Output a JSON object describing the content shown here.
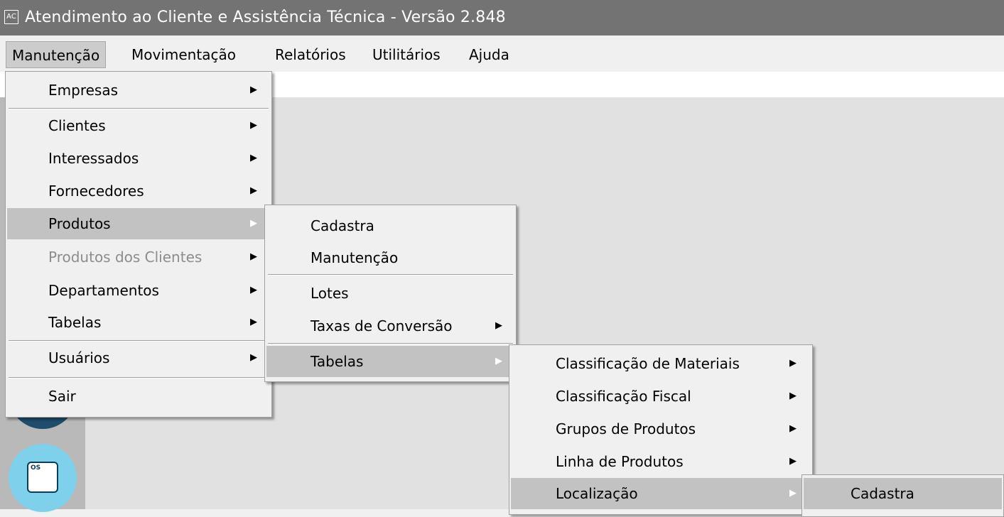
{
  "app": {
    "icon_label": "AC",
    "title": "Atendimento ao Cliente e Assistência Técnica - Versão 2.848"
  },
  "menubar": [
    {
      "label": "Manutenção"
    },
    {
      "label": "Movimentação"
    },
    {
      "label": "Relatórios"
    },
    {
      "label": "Utilitários"
    },
    {
      "label": "Ajuda"
    }
  ],
  "sidebar": {
    "puzzle_icon_label": "OS"
  },
  "menus": {
    "manutencao": {
      "items": [
        {
          "label": "Empresas",
          "submenu": true
        },
        {
          "label": "Clientes",
          "submenu": true
        },
        {
          "label": "Interessados",
          "submenu": true
        },
        {
          "label": "Fornecedores",
          "submenu": true
        },
        {
          "label": "Produtos",
          "submenu": true,
          "highlighted": true
        },
        {
          "label": "Produtos dos Clientes",
          "submenu": true,
          "disabled": true
        },
        {
          "label": "Departamentos",
          "submenu": true
        },
        {
          "label": "Tabelas",
          "submenu": true
        },
        {
          "label": "Usuários",
          "submenu": true
        },
        {
          "label": "Sair",
          "submenu": false
        }
      ]
    },
    "produtos": {
      "items": [
        {
          "label": "Cadastra",
          "submenu": false
        },
        {
          "label": "Manutenção",
          "submenu": false
        },
        {
          "label": "Lotes",
          "submenu": false
        },
        {
          "label": "Taxas de Conversão",
          "submenu": true
        },
        {
          "label": "Tabelas",
          "submenu": true,
          "highlighted": true
        }
      ]
    },
    "tabelas": {
      "items": [
        {
          "label": "Classificação de Materiais",
          "submenu": true
        },
        {
          "label": "Classificação Fiscal",
          "submenu": true
        },
        {
          "label": "Grupos de Produtos",
          "submenu": true
        },
        {
          "label": "Linha de Produtos",
          "submenu": true
        },
        {
          "label": "Localização",
          "submenu": true,
          "highlighted": true
        }
      ]
    },
    "localizacao": {
      "items": [
        {
          "label": "Cadastra",
          "submenu": false,
          "highlighted": true
        }
      ]
    }
  },
  "icons": {
    "submenu_arrow": "▶"
  }
}
